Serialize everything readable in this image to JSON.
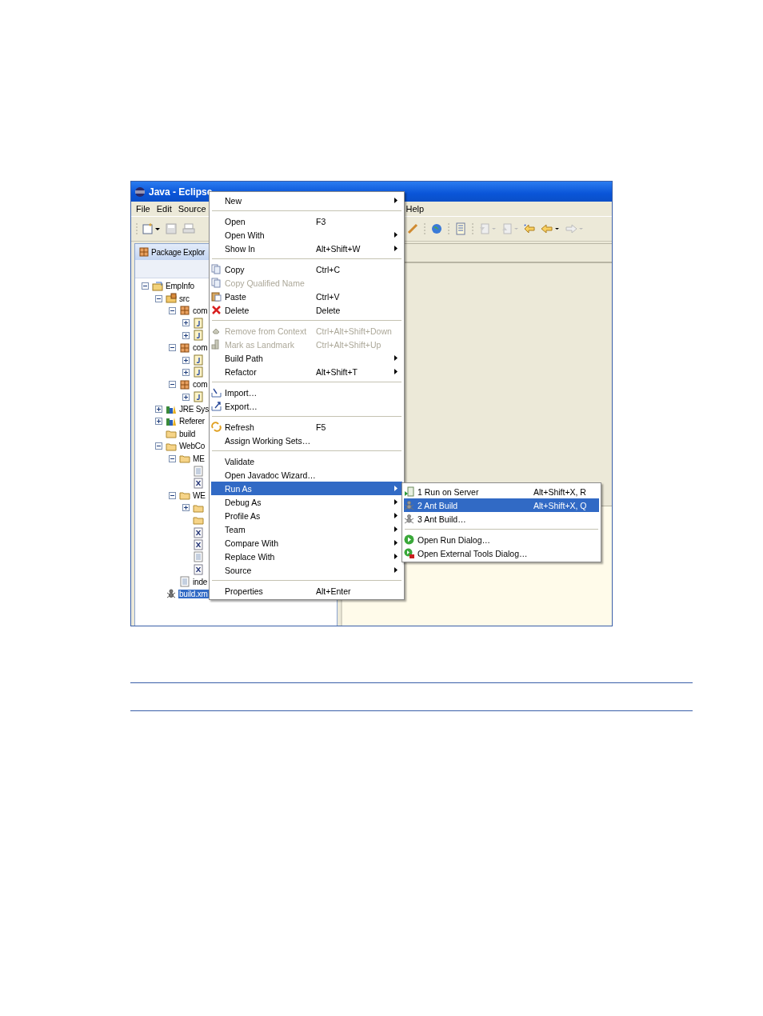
{
  "window": {
    "title": "Java - Eclipse"
  },
  "menu_bar": [
    "File",
    "Edit",
    "Source",
    "Help"
  ],
  "view_tab": {
    "label": "Package Explor"
  },
  "tree": [
    {
      "label": "EmpInfo",
      "kind": "project",
      "expanded": true,
      "selected": false,
      "children": [
        {
          "label": "src",
          "kind": "source",
          "expanded": true,
          "selected": false,
          "children": [
            {
              "label": "com",
              "kind": "package",
              "expanded": true,
              "selected": false,
              "children": [
                {
                  "kind": "java",
                  "expanded": false,
                  "selected": false
                },
                {
                  "kind": "java",
                  "expanded": false,
                  "selected": false
                }
              ]
            },
            {
              "label": "com",
              "kind": "package",
              "expanded": true,
              "selected": false,
              "children": [
                {
                  "kind": "java",
                  "expanded": false,
                  "selected": false
                },
                {
                  "kind": "java",
                  "expanded": false,
                  "selected": false
                }
              ]
            },
            {
              "label": "com",
              "kind": "package",
              "expanded": true,
              "selected": false,
              "children": [
                {
                  "kind": "java",
                  "expanded": false,
                  "selected": false
                }
              ]
            }
          ]
        },
        {
          "label": "JRE Sys",
          "kind": "library",
          "expanded": false,
          "selected": false
        },
        {
          "label": "Referer",
          "kind": "library",
          "expanded": false,
          "selected": false
        },
        {
          "label": "build",
          "kind": "folder",
          "selected": false
        },
        {
          "label": "WebCo",
          "kind": "folder",
          "expanded": true,
          "selected": false,
          "children": [
            {
              "label": "ME",
              "kind": "folder",
              "expanded": true,
              "selected": false,
              "children": [
                {
                  "kind": "file",
                  "selected": false
                },
                {
                  "kind": "xml",
                  "selected": false
                }
              ]
            },
            {
              "label": "WE",
              "kind": "folder",
              "expanded": true,
              "selected": false,
              "children": [
                {
                  "kind": "folder",
                  "expanded": false,
                  "selected": false
                },
                {
                  "kind": "folder",
                  "selected": false
                },
                {
                  "kind": "xml",
                  "selected": false
                },
                {
                  "kind": "xml",
                  "selected": false
                },
                {
                  "kind": "file",
                  "selected": false
                },
                {
                  "kind": "xml",
                  "selected": false
                }
              ]
            },
            {
              "label": "inde",
              "kind": "file",
              "selected": false
            }
          ]
        },
        {
          "label": "build.xm",
          "kind": "ant",
          "selected": true
        }
      ]
    }
  ],
  "context_menu": [
    {
      "kind": "item",
      "label": "New",
      "submenu": true,
      "disabled": false,
      "selected": false
    },
    {
      "kind": "separator"
    },
    {
      "kind": "item",
      "label": "Open",
      "shortcut": "F3",
      "submenu": false,
      "disabled": false,
      "selected": false
    },
    {
      "kind": "item",
      "label": "Open With",
      "submenu": true,
      "disabled": false,
      "selected": false
    },
    {
      "kind": "item",
      "label": "Show In",
      "shortcut": "Alt+Shift+W",
      "submenu": true,
      "disabled": false,
      "selected": false
    },
    {
      "kind": "separator"
    },
    {
      "kind": "item",
      "label": "Copy",
      "shortcut": "Ctrl+C",
      "submenu": false,
      "disabled": false,
      "selected": false
    },
    {
      "kind": "item",
      "label": "Copy Qualified Name",
      "submenu": false,
      "disabled": true,
      "selected": false
    },
    {
      "kind": "item",
      "label": "Paste",
      "shortcut": "Ctrl+V",
      "submenu": false,
      "disabled": false,
      "selected": false
    },
    {
      "kind": "item",
      "label": "Delete",
      "shortcut": "Delete",
      "submenu": false,
      "disabled": false,
      "selected": false
    },
    {
      "kind": "separator"
    },
    {
      "kind": "item",
      "label": "Remove from Context",
      "shortcut": "Ctrl+Alt+Shift+Down",
      "submenu": false,
      "disabled": true,
      "selected": false
    },
    {
      "kind": "item",
      "label": "Mark as Landmark",
      "shortcut": "Ctrl+Alt+Shift+Up",
      "submenu": false,
      "disabled": true,
      "selected": false
    },
    {
      "kind": "item",
      "label": "Build Path",
      "submenu": true,
      "disabled": false,
      "selected": false
    },
    {
      "kind": "item",
      "label": "Refactor",
      "shortcut": "Alt+Shift+T",
      "submenu": true,
      "disabled": false,
      "selected": false
    },
    {
      "kind": "separator"
    },
    {
      "kind": "item",
      "label": "Import…",
      "submenu": false,
      "disabled": false,
      "selected": false
    },
    {
      "kind": "item",
      "label": "Export…",
      "submenu": false,
      "disabled": false,
      "selected": false
    },
    {
      "kind": "separator"
    },
    {
      "kind": "item",
      "label": "Refresh",
      "shortcut": "F5",
      "submenu": false,
      "disabled": false,
      "selected": false
    },
    {
      "kind": "item",
      "label": "Assign Working Sets…",
      "submenu": false,
      "disabled": false,
      "selected": false
    },
    {
      "kind": "separator"
    },
    {
      "kind": "item",
      "label": "Validate",
      "submenu": false,
      "disabled": false,
      "selected": false
    },
    {
      "kind": "item",
      "label": "Open Javadoc Wizard…",
      "submenu": false,
      "disabled": false,
      "selected": false
    },
    {
      "kind": "item",
      "label": "Run As",
      "submenu": true,
      "disabled": false,
      "selected": true
    },
    {
      "kind": "item",
      "label": "Debug As",
      "submenu": true,
      "disabled": false,
      "selected": false
    },
    {
      "kind": "item",
      "label": "Profile As",
      "submenu": true,
      "disabled": false,
      "selected": false
    },
    {
      "kind": "item",
      "label": "Team",
      "submenu": true,
      "disabled": false,
      "selected": false
    },
    {
      "kind": "item",
      "label": "Compare With",
      "submenu": true,
      "disabled": false,
      "selected": false
    },
    {
      "kind": "item",
      "label": "Replace With",
      "submenu": true,
      "disabled": false,
      "selected": false
    },
    {
      "kind": "item",
      "label": "Source",
      "submenu": true,
      "disabled": false,
      "selected": false
    },
    {
      "kind": "separator"
    },
    {
      "kind": "item",
      "label": "Properties",
      "shortcut": "Alt+Enter",
      "submenu": false,
      "disabled": false,
      "selected": false
    }
  ],
  "submenu": [
    {
      "kind": "item",
      "label": "1 Run on Server",
      "shortcut": "Alt+Shift+X, R",
      "selected": false
    },
    {
      "kind": "item",
      "label": "2 Ant Build",
      "shortcut": "Alt+Shift+X, Q",
      "selected": true
    },
    {
      "kind": "item",
      "label": "3 Ant Build…",
      "selected": false
    },
    {
      "kind": "separator"
    },
    {
      "kind": "item",
      "label": "Open Run Dialog…",
      "selected": false
    },
    {
      "kind": "item",
      "label": "Open External Tools Dialog…",
      "selected": false
    }
  ]
}
